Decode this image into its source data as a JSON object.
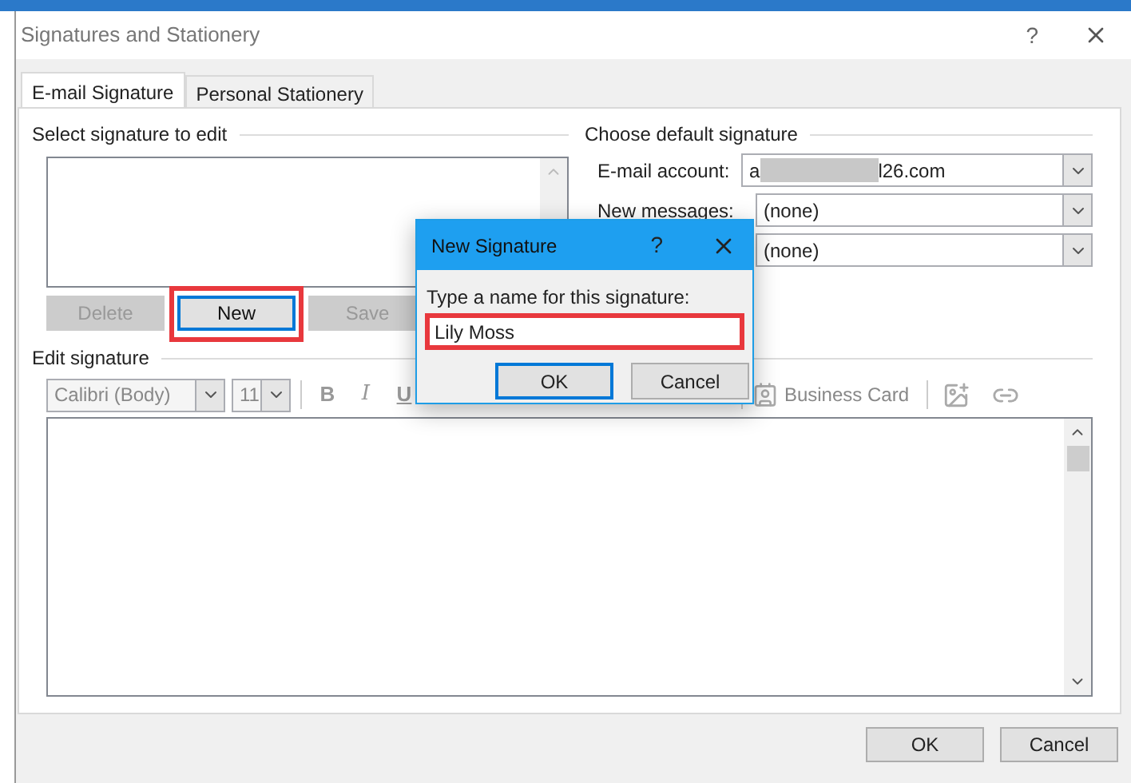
{
  "dialog": {
    "title": "Signatures and Stationery",
    "help": "?"
  },
  "tabs": [
    {
      "label": "E-mail Signature",
      "selected": true
    },
    {
      "label": "Personal Stationery",
      "selected": false
    }
  ],
  "select_signature": {
    "heading": "Select signature to edit",
    "buttons": [
      {
        "label": "Delete",
        "disabled": true,
        "highlighted": false,
        "focused": false
      },
      {
        "label": "New",
        "disabled": false,
        "highlighted": true,
        "focused": true
      },
      {
        "label": "Save",
        "disabled": true,
        "highlighted": false,
        "focused": false
      }
    ]
  },
  "default_signature": {
    "heading": "Choose default signature",
    "fields": [
      {
        "label": "E-mail account:",
        "value_start": "a",
        "value_end": "l26.com",
        "redacted": true
      },
      {
        "label": "New messages:",
        "value": "(none)",
        "redacted": false
      },
      {
        "value": "(none)",
        "redacted": false
      }
    ]
  },
  "edit_signature": {
    "heading": "Edit signature",
    "font": "Calibri (Body)",
    "size": "11",
    "format_buttons": [
      {
        "label": "B",
        "kind": "bold"
      },
      {
        "label": "I",
        "kind": "italic"
      },
      {
        "label": "U",
        "kind": "underline"
      }
    ],
    "business_card": "Business Card"
  },
  "footer_buttons": [
    "OK",
    "Cancel"
  ],
  "new_signature": {
    "title": "New Signature",
    "help": "?",
    "prompt": "Type a name for this signature:",
    "value": "Lily Moss",
    "highlighted": true,
    "buttons": [
      {
        "label": "OK",
        "focused": true
      },
      {
        "label": "Cancel",
        "focused": false
      }
    ]
  }
}
